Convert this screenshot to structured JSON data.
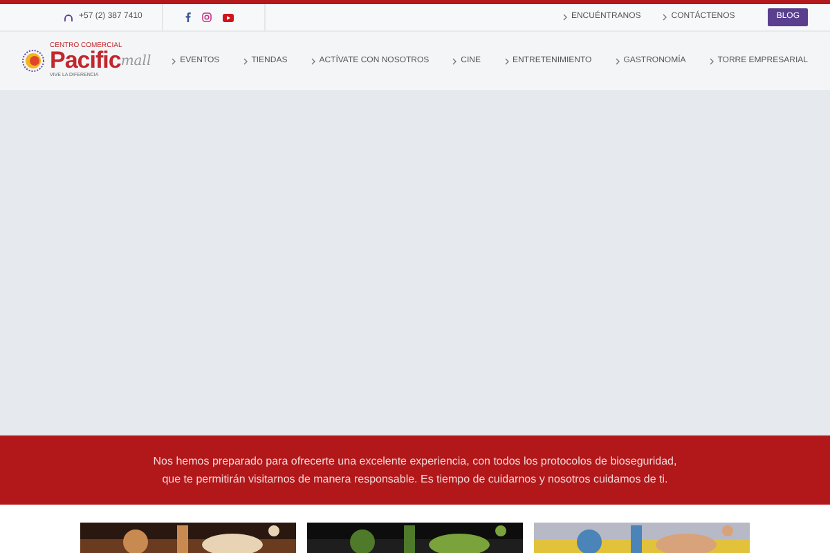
{
  "topbar": {
    "phone": "+57 (2) 387 7410",
    "social": [
      {
        "kind": "facebook"
      },
      {
        "kind": "instagram"
      },
      {
        "kind": "youtube"
      }
    ],
    "links": [
      "ENCUÉNTRANOS",
      "CONTÁCTENOS"
    ],
    "blog": "BLOG"
  },
  "logo": {
    "tagline_top": "CENTRO COMERCIAL",
    "brand": "Pacific",
    "script": "mall",
    "slogan": "VIVE LA DIFERENCIA"
  },
  "nav": [
    "EVENTOS",
    "TIENDAS",
    "ACTÍVATE CON NOSOTROS",
    "CINE",
    "ENTRETENIMIENTO",
    "GASTRONOMÍA",
    "TORRE EMPRESARIAL"
  ],
  "banner": {
    "lines": [
      "Nos hemos preparado para ofrecerte una excelente experiencia, con todos los protocolos de bioseguridad,",
      "que te permitirán visitarnos de manera responsable. Es tiempo de cuidarnos y nosotros cuidamos de ti."
    ]
  }
}
